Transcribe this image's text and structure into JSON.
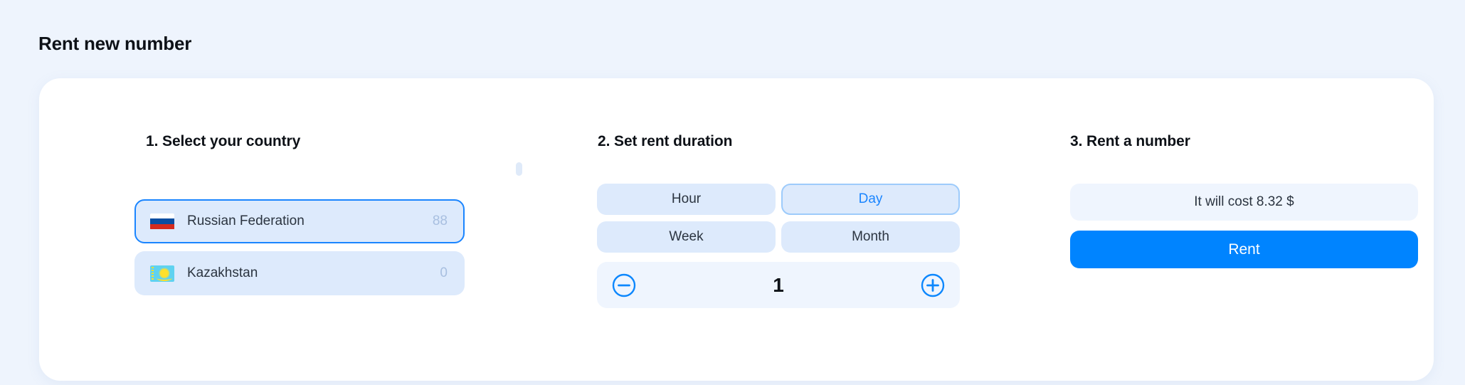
{
  "page": {
    "title": "Rent new number"
  },
  "country_step": {
    "heading": "1. Select your country",
    "countries": [
      {
        "name": "Russian Federation",
        "count": "88",
        "flag": "flag-ru-icon",
        "selected": true
      },
      {
        "name": "Kazakhstan",
        "count": "0",
        "flag": "flag-kz-icon",
        "selected": false
      }
    ]
  },
  "duration_step": {
    "heading": "2. Set rent duration",
    "options": [
      {
        "label": "Hour",
        "selected": false
      },
      {
        "label": "Day",
        "selected": true
      },
      {
        "label": "Week",
        "selected": false
      },
      {
        "label": "Month",
        "selected": false
      }
    ],
    "stepper": {
      "value": "1",
      "decrement_icon": "minus-circle-icon",
      "increment_icon": "plus-circle-icon"
    }
  },
  "rent_step": {
    "heading": "3. Rent a number",
    "cost_text": "It will cost 8.32 $",
    "rent_button_label": "Rent"
  },
  "colors": {
    "page_background": "#eef4fd",
    "card_background": "#ffffff",
    "accent_blue": "#0084ff",
    "selected_border": "#1a85ff",
    "chip_background": "#ddeafc",
    "soft_background": "#eff5fe",
    "muted_text": "#a8bfe0",
    "body_text": "#2b3440"
  }
}
